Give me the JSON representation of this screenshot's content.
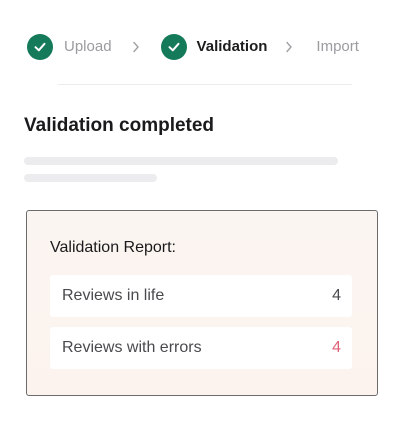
{
  "stepper": {
    "steps": [
      {
        "label": "Upload",
        "state": "completed",
        "icon": "check-icon"
      },
      {
        "label": "Validation",
        "state": "current-completed",
        "icon": "check-icon"
      },
      {
        "label": "Import",
        "state": "upcoming"
      }
    ],
    "separator_icon": "chevron-right-icon",
    "check_color": "#157a5a"
  },
  "main": {
    "title": "Validation completed"
  },
  "report": {
    "title": "Validation Report:",
    "rows": [
      {
        "label": "Reviews in life",
        "value": "4"
      },
      {
        "label": "Reviews with errors",
        "value": "4",
        "status_color": "#e0607a"
      }
    ]
  }
}
